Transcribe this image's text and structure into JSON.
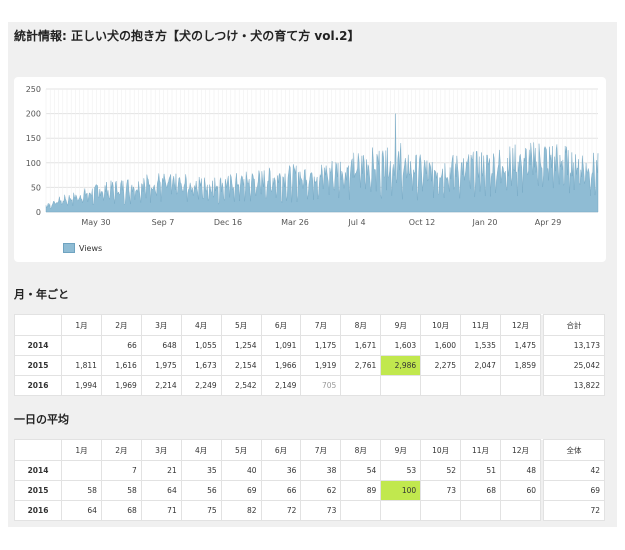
{
  "page": {
    "title": "統計情報: 正しい犬の抱き方【犬のしつけ・犬の育て方 vol.2】"
  },
  "chart": {
    "legend": "Views",
    "series_color": "#8fbcd4",
    "y_ticks": [
      "0",
      "50",
      "100",
      "150",
      "200",
      "250"
    ],
    "x_ticks": [
      "May 30",
      "Sep 7",
      "Dec 16",
      "Mar 26",
      "Jul 4",
      "Oct 12",
      "Jan 20",
      "Apr 29"
    ]
  },
  "chart_data": {
    "type": "area",
    "series": [
      {
        "name": "Views",
        "approx_daily_views_by_period": [
          15,
          40,
          55,
          48,
          60,
          70,
          90,
          75,
          85,
          100,
          80
        ]
      }
    ],
    "ylim": [
      0,
      250
    ],
    "peak": 200
  },
  "monthly": {
    "title": "月・年ごと",
    "headers": [
      "1月",
      "2月",
      "3月",
      "4月",
      "5月",
      "6月",
      "7月",
      "8月",
      "9月",
      "10月",
      "11月",
      "12月"
    ],
    "total_label": "合計",
    "rows": [
      {
        "year": "2014",
        "cells": [
          "",
          "66",
          "648",
          "1,055",
          "1,254",
          "1,091",
          "1,175",
          "1,671",
          "1,603",
          "1,600",
          "1,535",
          "1,475"
        ],
        "total": "13,173"
      },
      {
        "year": "2015",
        "cells": [
          "1,811",
          "1,616",
          "1,975",
          "1,673",
          "2,154",
          "1,966",
          "1,919",
          "2,761",
          "2,986",
          "2,275",
          "2,047",
          "1,859"
        ],
        "total": "25,042"
      },
      {
        "year": "2016",
        "cells": [
          "1,994",
          "1,969",
          "2,214",
          "2,249",
          "2,542",
          "2,149",
          "705",
          "",
          "",
          "",
          "",
          ""
        ],
        "total": "13,822"
      }
    ]
  },
  "daily": {
    "title": "一日の平均",
    "headers": [
      "1月",
      "2月",
      "3月",
      "4月",
      "5月",
      "6月",
      "7月",
      "8月",
      "9月",
      "10月",
      "11月",
      "12月"
    ],
    "total_label": "全体",
    "rows": [
      {
        "year": "2014",
        "cells": [
          "",
          "7",
          "21",
          "35",
          "40",
          "36",
          "38",
          "54",
          "53",
          "52",
          "51",
          "48"
        ],
        "total": "42"
      },
      {
        "year": "2015",
        "cells": [
          "58",
          "58",
          "64",
          "56",
          "69",
          "66",
          "62",
          "89",
          "100",
          "73",
          "68",
          "60"
        ],
        "total": "69"
      },
      {
        "year": "2016",
        "cells": [
          "64",
          "68",
          "71",
          "75",
          "82",
          "72",
          "73",
          "",
          "",
          "",
          "",
          ""
        ],
        "total": "72"
      }
    ]
  }
}
